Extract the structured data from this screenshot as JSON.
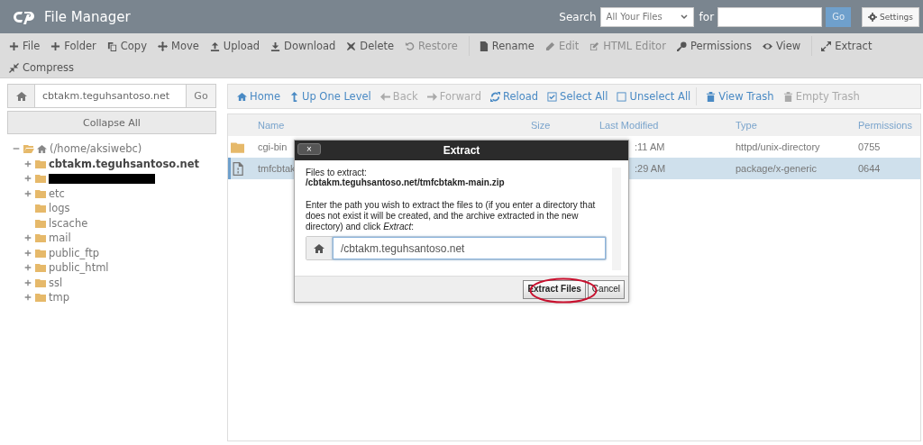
{
  "header": {
    "title": "File Manager",
    "search_label": "Search",
    "scope": "All Your Files",
    "for_label": "for",
    "go": "Go",
    "settings": "Settings"
  },
  "toolbar": {
    "rows": [
      {
        "items": [
          {
            "label": "File",
            "disabled": false,
            "divider_before": false
          },
          {
            "label": "Folder",
            "disabled": false,
            "divider_before": false
          },
          {
            "label": "Copy",
            "disabled": false,
            "divider_before": false
          },
          {
            "label": "Move",
            "disabled": false,
            "divider_before": false
          },
          {
            "label": "Upload",
            "disabled": false,
            "divider_before": false
          },
          {
            "label": "Download",
            "disabled": false,
            "divider_before": false
          },
          {
            "label": "Delete",
            "disabled": false,
            "divider_before": false
          },
          {
            "label": "Restore",
            "disabled": true,
            "divider_before": false
          },
          {
            "label": "Rename",
            "disabled": false,
            "divider_before": true
          },
          {
            "label": "Edit",
            "disabled": true,
            "divider_before": false
          },
          {
            "label": "HTML Editor",
            "disabled": true,
            "divider_before": false
          },
          {
            "label": "Permissions",
            "disabled": false,
            "divider_before": false
          },
          {
            "label": "View",
            "disabled": false,
            "divider_before": false
          },
          {
            "label": "Extract",
            "disabled": false,
            "divider_before": true
          }
        ]
      },
      {
        "items": [
          {
            "label": "Compress",
            "disabled": false,
            "divider_before": false
          }
        ]
      }
    ]
  },
  "path_bar": {
    "value": "cbtakm.teguhsantoso.net",
    "go": "Go"
  },
  "collapse_all": "Collapse All",
  "tree": [
    {
      "kind": "home",
      "label": "(/home/aksiwebc)",
      "expanded": true,
      "has_children": true,
      "selected": false,
      "children": [
        {
          "kind": "folder",
          "label": "cbtakm.teguhsantoso.net",
          "expanded": false,
          "has_children": true,
          "selected": true
        },
        {
          "kind": "redacted",
          "expanded": false,
          "has_children": true,
          "selected": false
        },
        {
          "kind": "folder",
          "label": "etc",
          "expanded": false,
          "has_children": true,
          "selected": false
        },
        {
          "kind": "folder",
          "label": "logs",
          "expanded": false,
          "has_children": false,
          "selected": false
        },
        {
          "kind": "folder",
          "label": "lscache",
          "expanded": false,
          "has_children": false,
          "selected": false
        },
        {
          "kind": "folder",
          "label": "mail",
          "expanded": false,
          "has_children": true,
          "selected": false
        },
        {
          "kind": "folder",
          "label": "public_ftp",
          "expanded": false,
          "has_children": true,
          "selected": false
        },
        {
          "kind": "folder",
          "label": "public_html",
          "expanded": false,
          "has_children": true,
          "selected": false
        },
        {
          "kind": "folder",
          "label": "ssl",
          "expanded": false,
          "has_children": true,
          "selected": false
        },
        {
          "kind": "folder",
          "label": "tmp",
          "expanded": false,
          "has_children": true,
          "selected": false
        }
      ]
    }
  ],
  "nav": [
    {
      "label": "Home",
      "disabled": false,
      "divider_before": false
    },
    {
      "label": "Up One Level",
      "disabled": false,
      "divider_before": false
    },
    {
      "label": "Back",
      "disabled": true,
      "divider_before": false
    },
    {
      "label": "Forward",
      "disabled": true,
      "divider_before": false
    },
    {
      "label": "Reload",
      "disabled": false,
      "divider_before": false
    },
    {
      "label": "Select All",
      "disabled": false,
      "divider_before": false
    },
    {
      "label": "Unselect All",
      "disabled": false,
      "divider_before": false
    },
    {
      "label": "View Trash",
      "disabled": false,
      "divider_before": true
    },
    {
      "label": "Empty Trash",
      "disabled": true,
      "divider_before": false
    }
  ],
  "table": {
    "columns": [
      "Name",
      "Size",
      "Last Modified",
      "Type",
      "Permissions"
    ],
    "rows": [
      {
        "kind": "folder",
        "name": "cgi-bin",
        "last_modified": ":11 AM",
        "type": "httpd/unix-directory",
        "permissions": "0755",
        "selected": false
      },
      {
        "kind": "file",
        "name": "tmfcbtak",
        "last_modified": ":29 AM",
        "type": "package/x-generic",
        "permissions": "0644",
        "selected": true
      }
    ]
  },
  "dialog": {
    "title": "Extract",
    "close": "×",
    "files_label": "Files to extract:",
    "file_path": "/cbtakm.teguhsantoso.net/tmfcbtakm-main.zip",
    "instructions": "Enter the path you wish to extract the files to (if you enter a directory that does not exist it will be created, and the archive extracted in the new directory) and click *Extract*:",
    "path_value": "/cbtakm.teguhsantoso.net",
    "buttons": [
      "Extract Files",
      "Cancel"
    ]
  }
}
